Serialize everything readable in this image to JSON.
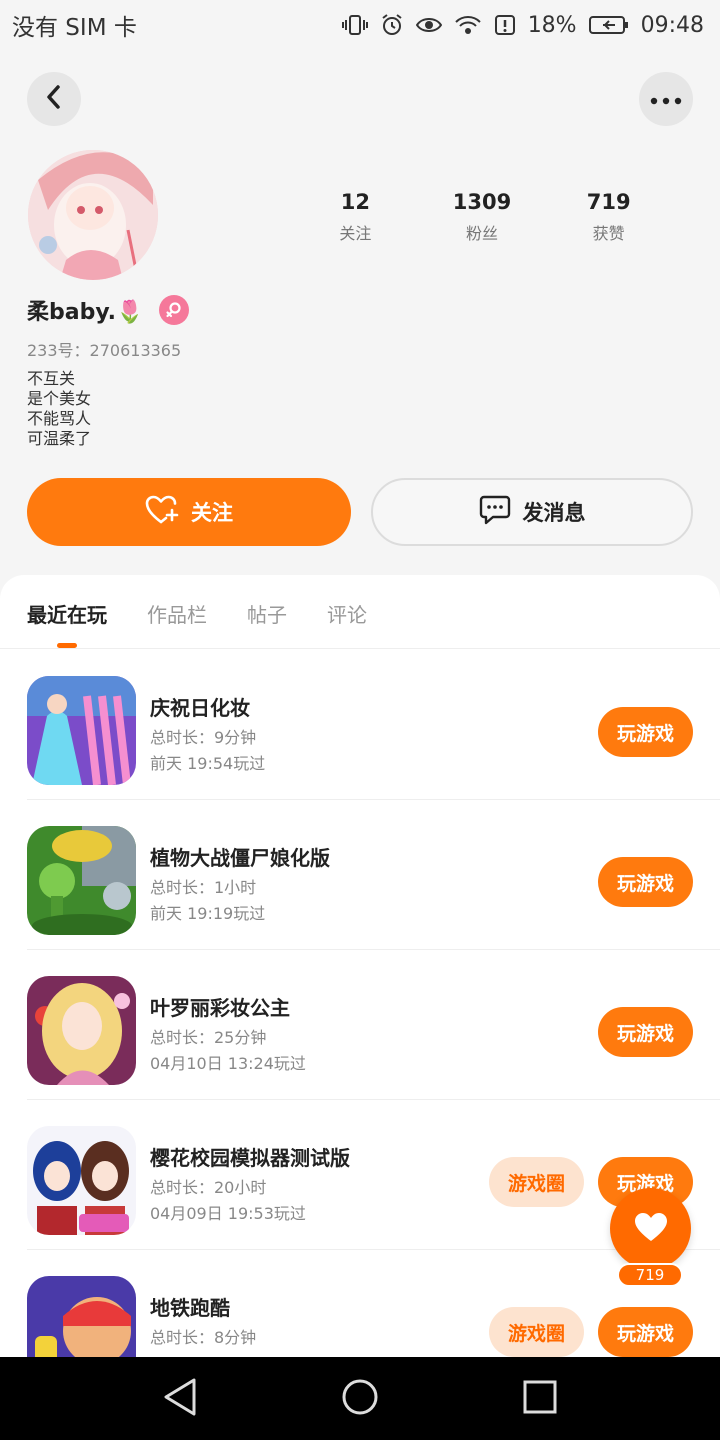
{
  "status_bar": {
    "carrier": "没有 SIM 卡",
    "battery": "18%",
    "time": "09:48"
  },
  "profile": {
    "username": "柔baby.🌷",
    "uid": "233号：270613365",
    "bio": [
      "不互关",
      "是个美女",
      "不能骂人",
      "可温柔了"
    ],
    "stats": [
      {
        "value": "12",
        "label": "关注"
      },
      {
        "value": "1309",
        "label": "粉丝"
      },
      {
        "value": "719",
        "label": "获赞"
      }
    ],
    "gender": "female"
  },
  "actions": {
    "follow_label": "关注",
    "message_label": "发消息"
  },
  "tabs": [
    "最近在玩",
    "作品栏",
    "帖子",
    "评论"
  ],
  "games": [
    {
      "title": "庆祝日化妆",
      "duration": "总时长：9分钟",
      "last_played": "前天 19:54玩过",
      "play_label": "玩游戏",
      "circle_label": ""
    },
    {
      "title": "植物大战僵尸娘化版",
      "duration": "总时长：1小时",
      "last_played": "前天 19:19玩过",
      "play_label": "玩游戏",
      "circle_label": ""
    },
    {
      "title": "叶罗丽彩妆公主",
      "duration": "总时长：25分钟",
      "last_played": "04月10日 13:24玩过",
      "play_label": "玩游戏",
      "circle_label": ""
    },
    {
      "title": "樱花校园模拟器测试版",
      "duration": "总时长：20小时",
      "last_played": "04月09日 19:53玩过",
      "play_label": "玩游戏",
      "circle_label": "游戏圈"
    },
    {
      "title": "地铁跑酷",
      "duration": "总时长：8分钟",
      "last_played": "",
      "play_label": "玩游戏",
      "circle_label": "游戏圈"
    }
  ],
  "like_fab": {
    "count": "719"
  },
  "colors": {
    "accent": "#ff7a0e",
    "accent_light": "#fde3cf",
    "background": "#f5f5f5"
  }
}
